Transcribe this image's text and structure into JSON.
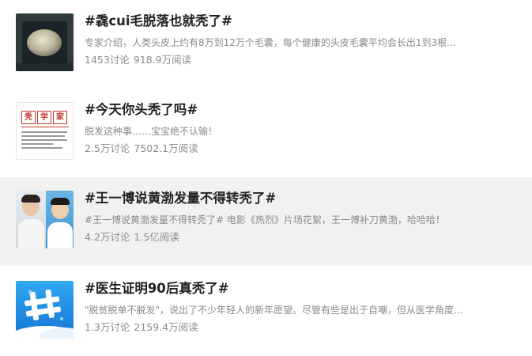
{
  "topics": [
    {
      "title": "#毳cui毛脱落也就秃了#",
      "desc": "专家介绍，人类头皮上约有8万到12万个毛囊，每个健康的头皮毛囊平均会长出1到3根...",
      "discussions": "1453讨论",
      "reads": "918.9万阅读",
      "thumb_icon": "scalp-photo"
    },
    {
      "title": "#今天你头秃了吗#",
      "desc": "脱发这种事……宝宝绝不认输！",
      "discussions": "2.5万讨论",
      "reads": "7502.1万阅读",
      "thumb_icon": "document-thumbnail",
      "thumb_text": [
        "秃",
        "学",
        "家"
      ]
    },
    {
      "title": "#王一博说黄渤发量不得转秃了#",
      "desc": "#王一博说黄渤发量不得转秃了# 电影《热烈》片场花絮，王一博补刀黄渤，哈哈哈！",
      "discussions": "4.2万讨论",
      "reads": "1.5亿阅读",
      "thumb_icon": "two-people-photo"
    },
    {
      "title": "#医生证明90后真秃了#",
      "desc": "\"脱贫脱单不脱发\"，说出了不少年轻人的新年愿望。尽管有些是出于自嘲，但从医学角度...",
      "discussions": "1.3万讨论",
      "reads": "2159.4万阅读",
      "thumb_icon": "hashtag-icon"
    }
  ],
  "colors": {
    "highlight_bg": "#f1f1f1",
    "title": "#222222",
    "meta": "#8a8a8a",
    "hashtag_blue": "#1f8ae6"
  }
}
